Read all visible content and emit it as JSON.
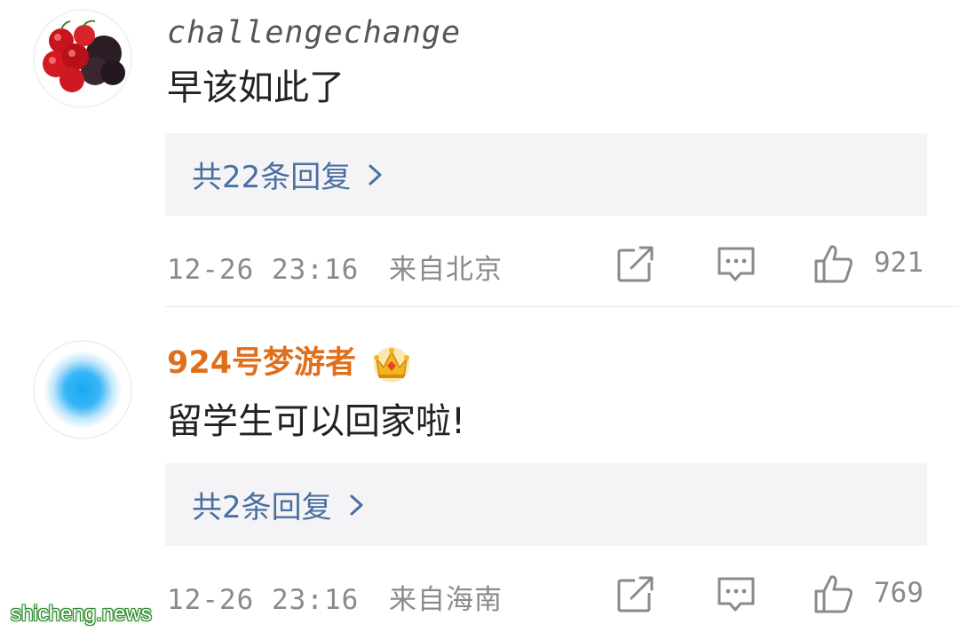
{
  "comments": [
    {
      "username": "challengechange",
      "content": "早该如此了",
      "replies_label": "共22条回复",
      "timestamp": "12-26 23:16",
      "location": "来自北京",
      "likes": "921"
    },
    {
      "username": "924号梦游者",
      "content": "留学生可以回家啦!",
      "replies_label": "共2条回复",
      "timestamp": "12-26 23:16",
      "location": "来自海南",
      "likes": "769"
    }
  ],
  "icons": {
    "share": "share-icon",
    "comment": "comment-icon",
    "like": "thumbs-up-icon",
    "chevron": "chevron-right-icon",
    "crown": "crown-icon"
  },
  "colors": {
    "username_vip": "#e06f1c",
    "reply_link": "#4a6fa0",
    "meta_text": "#8a8a8a",
    "reply_box_bg": "#f4f4f6"
  },
  "watermark": "shicheng.news"
}
